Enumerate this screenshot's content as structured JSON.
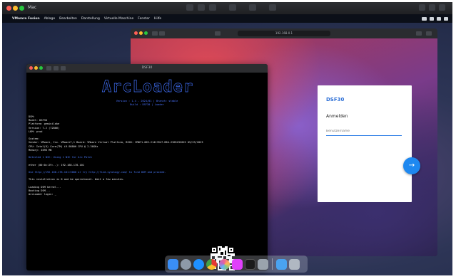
{
  "host": {
    "title": "Mac",
    "traffic_lights": [
      "#ff5f57",
      "#febc2e",
      "#28c840"
    ]
  },
  "menubar": {
    "apple": "",
    "app_name": "VMware Fusion",
    "items": [
      "Ablage",
      "Bearbeiten",
      "Darstellung",
      "Virtuelle Maschine",
      "Fenster",
      "Hilfe"
    ]
  },
  "browser": {
    "url": "192.168.0.1"
  },
  "login": {
    "title": "DSF30",
    "heading": "Anmelden",
    "placeholder": "Benutzername",
    "go_icon": "arrow-right-icon"
  },
  "terminal": {
    "title": "DSF30",
    "logo": "ArcLoader",
    "subtitle1": "Version : 1.4 - 2024/01 | Branch: stable",
    "subtitle2": "Build : DSF30 | Loader",
    "lines": [
      {
        "text": "DSM:",
        "color": "white"
      },
      {
        "text": "Model: DSF30",
        "color": "white"
      },
      {
        "text": "Platform: geminilake",
        "color": "white"
      },
      {
        "text": "Version: 7.2 (72806)",
        "color": "white"
      },
      {
        "text": "LKM: prod",
        "color": "white"
      },
      {
        "text": "",
        "color": "white"
      },
      {
        "text": "System:",
        "color": "white"
      },
      {
        "text": "Vendor: VMware, Inc. VMware7,1 Board: VMware Virtual Platform, BIOS: VMW71.00V.21417647.B64.2305232025 05/23/2023",
        "color": "white"
      },
      {
        "text": "CPU: Intel(R) Core(TM) i9-9880H CPU @ 2.30GHz",
        "color": "white"
      },
      {
        "text": "Memory: 4096 MB",
        "color": "white"
      },
      {
        "text": "",
        "color": "white"
      },
      {
        "text": "Detected 1 NIC: Using 1 NIC for Arc Patch",
        "color": "blue"
      },
      {
        "text": "",
        "color": "white"
      },
      {
        "text": "ether (00:0c:29:..): 192.168.178.101",
        "color": "white"
      },
      {
        "text": "",
        "color": "white"
      },
      {
        "text": "Use http://192.168.178.101:5000 or try http://find.synology.com/ to find DSM and proceed.",
        "color": "blue"
      },
      {
        "text": "",
        "color": "white"
      },
      {
        "text": "This installation is 0 and be operational. Wait a few minutes.",
        "color": "white"
      },
      {
        "text": "",
        "color": "white"
      },
      {
        "text": "Loading DSM kernel...",
        "color": "white"
      },
      {
        "text": "Booting DSM...",
        "color": "white"
      },
      {
        "text": "ArcLoader login: _",
        "color": "white"
      }
    ]
  },
  "dock": {
    "icons": [
      {
        "name": "finder-icon",
        "color": "#3a8ef6"
      },
      {
        "name": "launchpad-icon",
        "color": "#8e9aa8"
      },
      {
        "name": "safari-icon",
        "color": "#1e90ff"
      },
      {
        "name": "chrome-icon",
        "color": "#e8e8e8"
      },
      {
        "name": "photos-icon",
        "color": "#f06292"
      },
      {
        "name": "app-icon",
        "color": "#e040fb"
      },
      {
        "name": "terminal-icon",
        "color": "#1b1b1b"
      },
      {
        "name": "system-preferences-icon",
        "color": "#9aa3ad"
      },
      {
        "name": "folder-icon",
        "color": "#4aa3f0"
      },
      {
        "name": "trash-icon",
        "color": "#b0b8c2"
      }
    ]
  }
}
